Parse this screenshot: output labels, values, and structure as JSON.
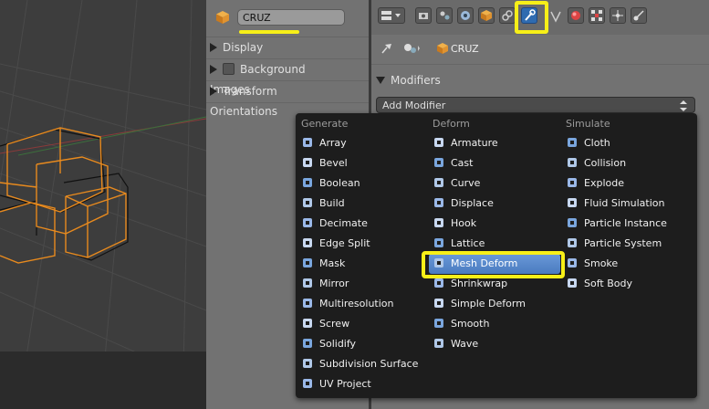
{
  "object": {
    "name": "CRUZ",
    "icon": "cube-icon"
  },
  "panels": [
    {
      "label": "Display",
      "type": "collapsed"
    },
    {
      "label": "Background Images",
      "type": "checkbox"
    },
    {
      "label": "Transform Orientations",
      "type": "collapsed"
    }
  ],
  "tabs": [
    "render-icon",
    "render-layers-icon",
    "scene-icon",
    "world-icon",
    "object-icon",
    "constraints-icon",
    "modifiers-icon",
    "data-icon",
    "material-icon",
    "texture-icon",
    "particles-icon",
    "physics-icon"
  ],
  "active_tab": "modifiers-icon",
  "context": {
    "object_label": "CRUZ"
  },
  "modifiers": {
    "header": "Modifiers",
    "add_button": "Add Modifier"
  },
  "menu": {
    "columns": [
      {
        "header": "Generate",
        "items": [
          "Array",
          "Bevel",
          "Boolean",
          "Build",
          "Decimate",
          "Edge Split",
          "Mask",
          "Mirror",
          "Multiresolution",
          "Screw",
          "Solidify",
          "Subdivision Surface",
          "UV Project"
        ]
      },
      {
        "header": "Deform",
        "items": [
          "Armature",
          "Cast",
          "Curve",
          "Displace",
          "Hook",
          "Lattice",
          "Mesh Deform",
          "Shrinkwrap",
          "Simple Deform",
          "Smooth",
          "Wave"
        ]
      },
      {
        "header": "Simulate",
        "items": [
          "Cloth",
          "Collision",
          "Explode",
          "Fluid Simulation",
          "Particle Instance",
          "Particle System",
          "Smoke",
          "Soft Body"
        ]
      }
    ],
    "highlighted": "Mesh Deform"
  },
  "colors": {
    "highlight": "#f7ef18",
    "active_blue": "#5a8bd0",
    "menu_bg": "#1d1d1d"
  }
}
